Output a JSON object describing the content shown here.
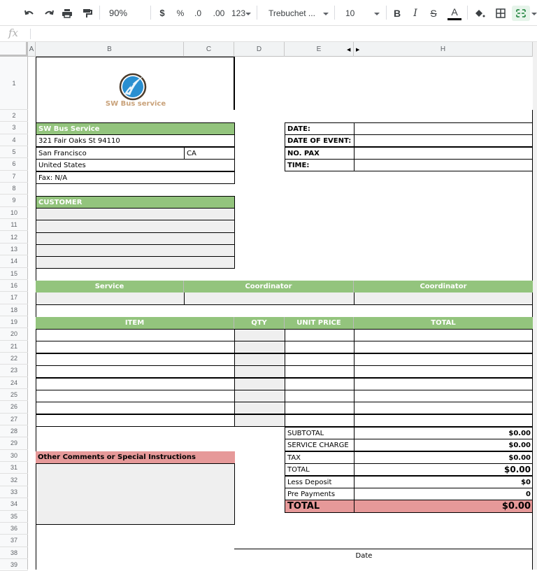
{
  "toolbar": {
    "zoom": "90%",
    "currency": "$",
    "percent": "%",
    "decrease_decimal": ".0",
    "increase_decimal": ".00",
    "more_formats": "123",
    "font": "Trebuchet ...",
    "font_size": "10",
    "bold": "B",
    "italic": "I",
    "strike": "S",
    "text_color": "A",
    "text_color_value": "#000000"
  },
  "formula_bar": {
    "fx": "fx",
    "value": ""
  },
  "columns": [
    "A",
    "B",
    "C",
    "D",
    "E",
    "H"
  ],
  "rows": [
    "1",
    "2",
    "3",
    "4",
    "5",
    "6",
    "7",
    "8",
    "9",
    "10",
    "11",
    "12",
    "13",
    "14",
    "15",
    "16",
    "17",
    "18",
    "19",
    "20",
    "21",
    "22",
    "23",
    "24",
    "25",
    "26",
    "27",
    "28",
    "29",
    "30",
    "31",
    "32",
    "33",
    "34",
    "35",
    "36",
    "37",
    "38",
    "39"
  ],
  "logo": {
    "text": "SW Bus service",
    "text_color": "#c9a27a",
    "icon_color": "#2a8fd0"
  },
  "company": {
    "header": "SW Bus Service",
    "address": "321 Fair Oaks St 94110",
    "city": "San Francisco",
    "state": "CA",
    "country": "United States",
    "fax": "Fax: N/A"
  },
  "event_info": [
    {
      "label": "DATE:",
      "value": ""
    },
    {
      "label": "DATE OF EVENT:",
      "value": ""
    },
    {
      "label": "NO. PAX",
      "value": ""
    },
    {
      "label": "TIME:",
      "value": ""
    }
  ],
  "customer": {
    "header": "CUSTOMER",
    "lines": [
      "",
      "",
      "",
      "",
      ""
    ]
  },
  "service_table": {
    "headers": [
      "Service",
      "Coordinator",
      "Coordinator"
    ],
    "values": [
      "",
      "",
      ""
    ]
  },
  "items_table": {
    "headers": [
      "ITEM",
      "QTY",
      "UNIT PRICE",
      "TOTAL"
    ],
    "rows": 8
  },
  "totals": [
    {
      "label": "SUBTOTAL",
      "value": "$0.00"
    },
    {
      "label": "SERVICE CHARGE",
      "value": "$0.00"
    },
    {
      "label": "TAX",
      "value": "$0.00"
    },
    {
      "label": "TOTAL",
      "value": "$0.00"
    },
    {
      "label": "Less Deposit",
      "value": "$0"
    },
    {
      "label": "Pre Payments",
      "value": "0"
    }
  ],
  "grand_total": {
    "label": "TOTAL",
    "value": "$0.00"
  },
  "comments": {
    "header": "Other Comments or Special Instructions",
    "value": ""
  },
  "signature": {
    "date_label": "Date"
  },
  "colors": {
    "green_header": "#93c47d",
    "pink_header": "#e69999",
    "input_gray": "#efefef"
  }
}
